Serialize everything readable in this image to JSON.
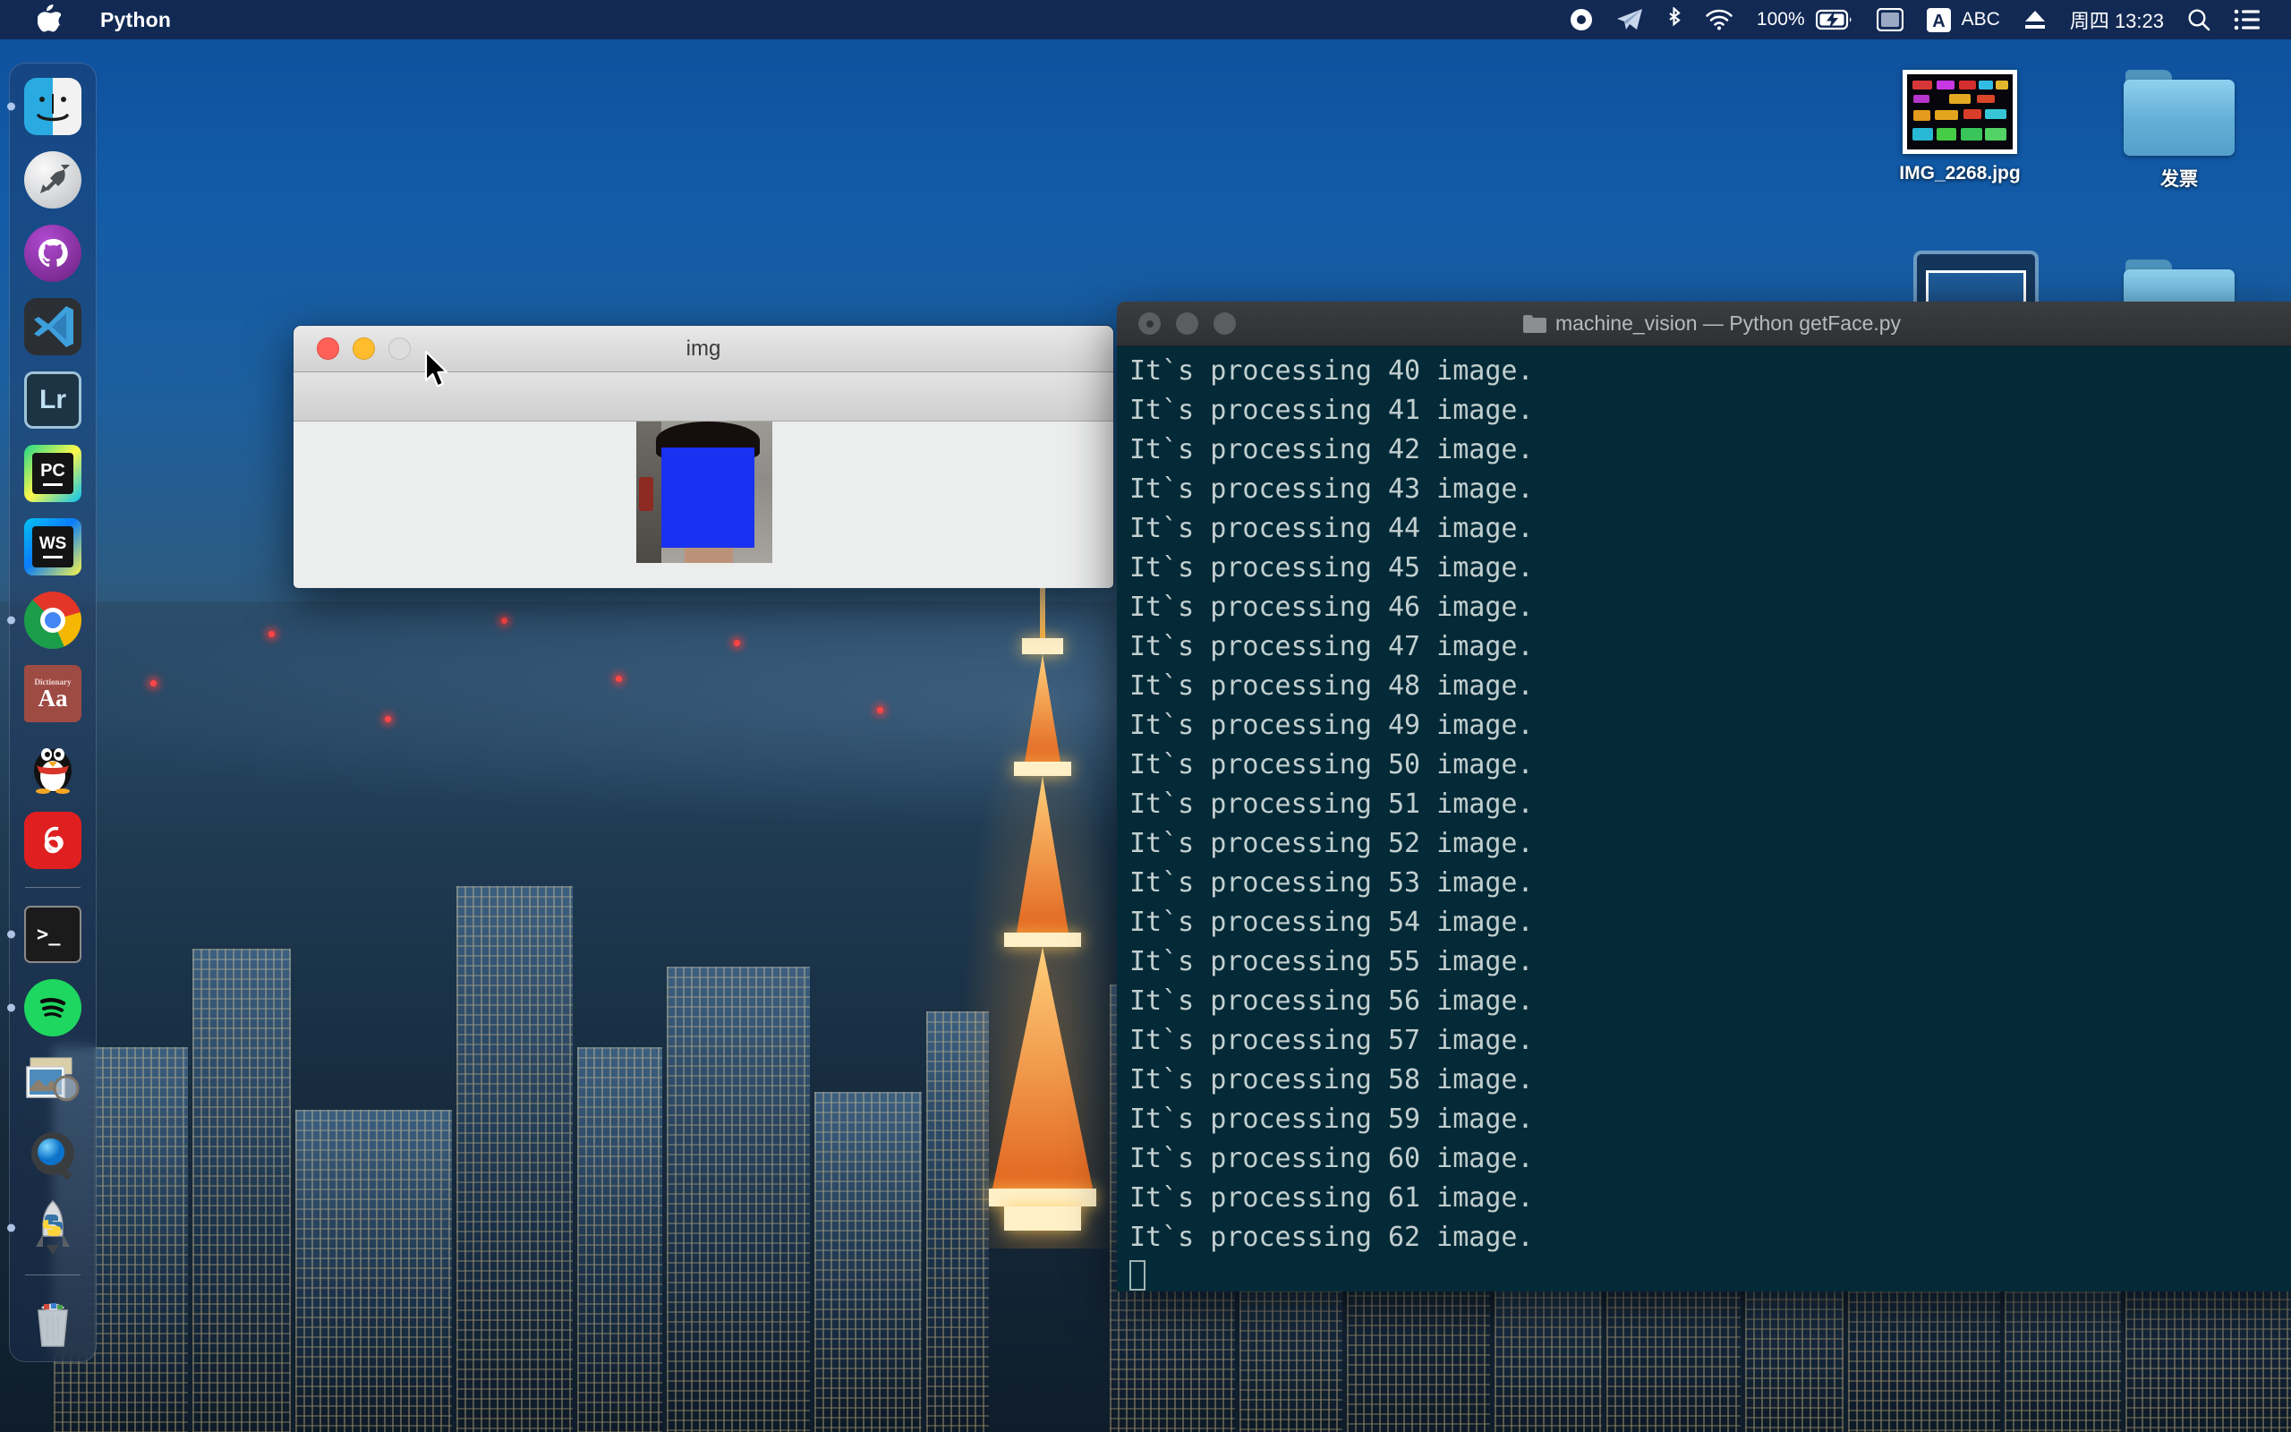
{
  "menubar": {
    "apple_logo": "",
    "app_name": "Python",
    "status": {
      "record_icon": "record-icon",
      "telegram_icon": "telegram-icon",
      "bluetooth_icon": "bluetooth-icon",
      "wifi_icon": "wifi-icon",
      "battery_percent": "100%",
      "battery_icon": "battery-charging-icon",
      "display_icon": "display-icon",
      "input_badge": "A",
      "input_label": "ABC",
      "eject_icon": "eject-icon",
      "clock": "周四 13:23",
      "search_icon": "search-icon",
      "controlcenter_icon": "list-icon"
    }
  },
  "dock": {
    "items": [
      {
        "name": "finder",
        "label": "Finder",
        "running": true
      },
      {
        "name": "launchpad",
        "label": "Launchpad",
        "running": false
      },
      {
        "name": "github-desktop",
        "label": "GitHub Desktop",
        "running": false
      },
      {
        "name": "visual-studio-code",
        "label": "Visual Studio Code",
        "running": false
      },
      {
        "name": "lightroom",
        "label": "Lr",
        "running": false
      },
      {
        "name": "pycharm",
        "label": "PC",
        "running": false
      },
      {
        "name": "webstorm",
        "label": "WS",
        "running": false
      },
      {
        "name": "google-chrome",
        "label": "Google Chrome",
        "running": true
      },
      {
        "name": "dictionary",
        "label": "Aa",
        "running": false
      },
      {
        "name": "qq",
        "label": "QQ",
        "running": false
      },
      {
        "name": "netease-music",
        "label": "NetEase Music",
        "running": false
      },
      {
        "name": "separator",
        "label": "",
        "running": false
      },
      {
        "name": "terminal",
        "label": ">_",
        "running": true
      },
      {
        "name": "spotify",
        "label": "Spotify",
        "running": true
      },
      {
        "name": "preview",
        "label": "Preview",
        "running": false
      },
      {
        "name": "quicktime-player",
        "label": "Q",
        "running": false
      },
      {
        "name": "python-launcher",
        "label": "Python",
        "running": true
      },
      {
        "name": "separator-2",
        "label": "",
        "running": false
      },
      {
        "name": "trash",
        "label": "Trash",
        "running": false
      }
    ]
  },
  "desktop": {
    "icons": [
      {
        "name": "img-2268-jpg",
        "label": "IMG_2268.jpg",
        "type": "image"
      },
      {
        "name": "fapiao-folder",
        "label": "发票",
        "type": "folder"
      },
      {
        "name": "screenshot-file",
        "label": "",
        "type": "screenshot"
      },
      {
        "name": "folder-2",
        "label": "",
        "type": "folder"
      }
    ]
  },
  "img_window": {
    "title": "img",
    "traffic": {
      "close": "close-button",
      "minimize": "minimize-button",
      "zoom": "zoom-button"
    },
    "content_description": "detected face with blue rectangle overlay"
  },
  "terminal": {
    "title": "machine_vision — Python getFace.py",
    "folder_icon": "folder-icon",
    "lines": [
      "It`s processing 40 image.",
      "It`s processing 41 image.",
      "It`s processing 42 image.",
      "It`s processing 43 image.",
      "It`s processing 44 image.",
      "It`s processing 45 image.",
      "It`s processing 46 image.",
      "It`s processing 47 image.",
      "It`s processing 48 image.",
      "It`s processing 49 image.",
      "It`s processing 50 image.",
      "It`s processing 51 image.",
      "It`s processing 52 image.",
      "It`s processing 53 image.",
      "It`s processing 54 image.",
      "It`s processing 55 image.",
      "It`s processing 56 image.",
      "It`s processing 57 image.",
      "It`s processing 58 image.",
      "It`s processing 59 image.",
      "It`s processing 60 image.",
      "It`s processing 61 image.",
      "It`s processing 62 image."
    ]
  },
  "colors": {
    "menubar_bg": "#12264E",
    "terminal_bg": "#042A38",
    "terminal_text": "#C2CFCF",
    "terminal_titlebar": "#2E3033",
    "face_box": "#1931F0",
    "desktop_blue": "#125BA8"
  }
}
